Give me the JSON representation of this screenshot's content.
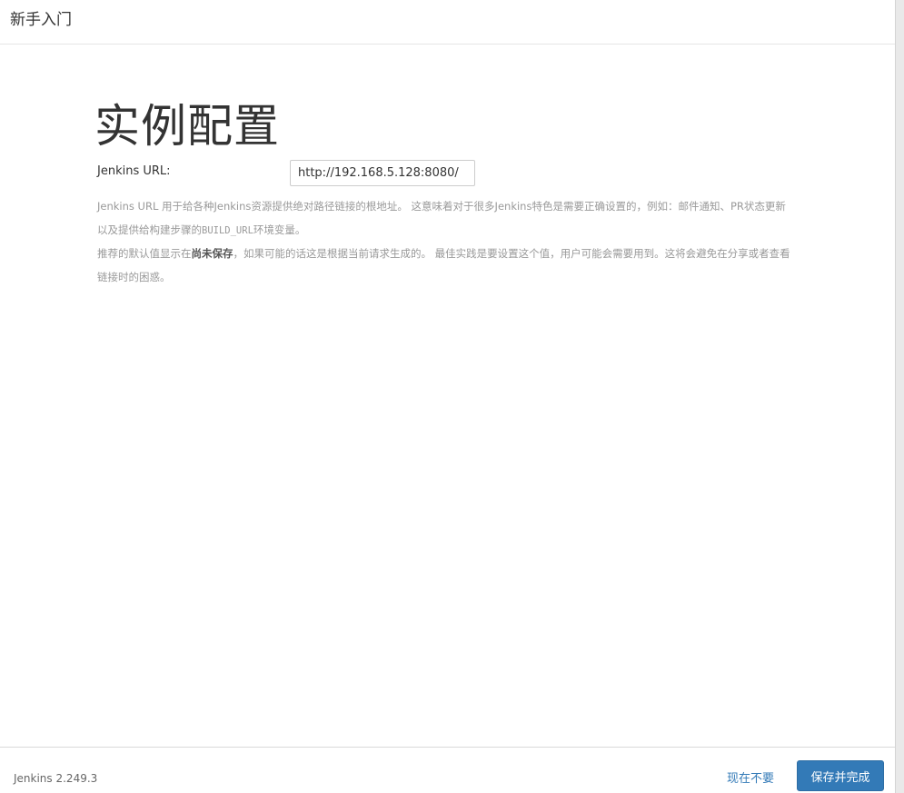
{
  "header": {
    "title": "新手入门"
  },
  "main": {
    "heading": "实例配置",
    "url_label": "Jenkins URL:",
    "url_value": "http://192.168.5.128:8080/",
    "help": {
      "line1_a": "Jenkins URL 用于给各种Jenkins资源提供绝对路径链接的根地址。 这意味着对于很多Jenkins特色是需要正确设置的，例如：邮件通知、PR状态更新以及提供给构建步骤的",
      "line1_code": "BUILD_URL",
      "line1_b": "环境变量。",
      "line2_a": "推荐的默认值显示在",
      "line2_bold": "尚未保存",
      "line2_b": "，如果可能的话这是根据当前请求生成的。 最佳实践是要设置这个值，用户可能会需要用到。这将会避免在分享或者查看链接时的困惑。"
    }
  },
  "footer": {
    "version": "Jenkins 2.249.3",
    "skip_label": "现在不要",
    "save_label": "保存并完成"
  },
  "colors": {
    "primary": "#337ab7",
    "link": "#337ab7"
  }
}
